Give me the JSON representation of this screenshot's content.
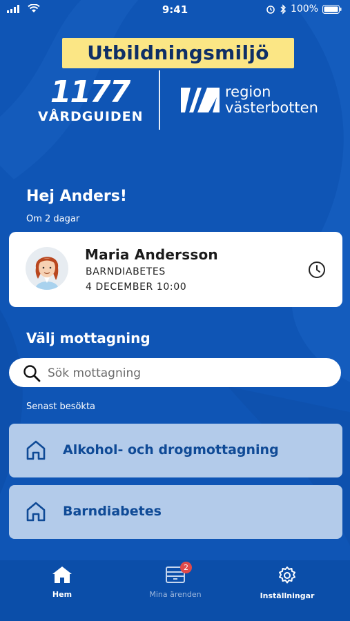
{
  "status_bar": {
    "time": "9:41",
    "battery": "100%"
  },
  "environment_label": "Utbildningsmiljö",
  "logo_1177": {
    "number": "1177",
    "name": "VÅRDGUIDEN"
  },
  "logo_region": {
    "line1": "region",
    "line2": "västerbotten"
  },
  "greeting": "Hej Anders!",
  "appointment": {
    "when": "Om 2 dagar",
    "name": "Maria Andersson",
    "department": "BARNDIABETES",
    "datetime": "4 DECEMBER 10:00"
  },
  "choose_heading": "Välj mottagning",
  "search": {
    "placeholder": "Sök mottagning"
  },
  "recent_label": "Senast besökta",
  "clinics": [
    {
      "label": "Alkohol- och drogmottagning"
    },
    {
      "label": "Barndiabetes"
    }
  ],
  "tabs": [
    {
      "label": "Hem",
      "icon": "home-icon"
    },
    {
      "label": "Mina ärenden",
      "icon": "inbox-icon",
      "badge": "2"
    },
    {
      "label": "Inställningar",
      "icon": "gear-icon"
    }
  ],
  "colors": {
    "background": "#0f55b5",
    "banner": "#fbe685",
    "clinic_card": "#b3cbea",
    "tabbar": "#0b4ea9"
  }
}
